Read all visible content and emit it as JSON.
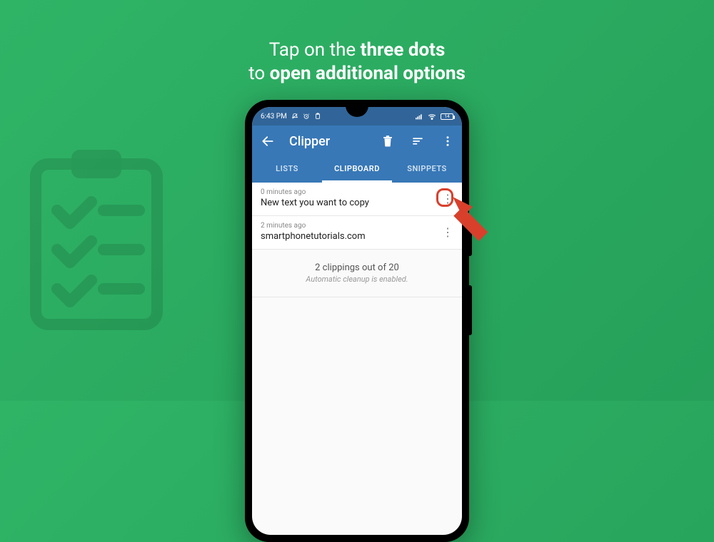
{
  "instruction": {
    "line1_pre": "Tap on the ",
    "line1_bold": "three dots",
    "line2_pre": "to ",
    "line2_bold": "open additional options"
  },
  "status": {
    "time": "6:43 PM",
    "battery": "14"
  },
  "appbar": {
    "title": "Clipper"
  },
  "tabs": {
    "lists": "LISTS",
    "clipboard": "CLIPBOARD",
    "snippets": "SNIPPETS",
    "active": "clipboard"
  },
  "items": [
    {
      "time": "0 minutes ago",
      "text": "New text you want to copy"
    },
    {
      "time": "2 minutes ago",
      "text": "smartphonetutorials.com"
    }
  ],
  "summary": {
    "count": "2 clippings out of 20",
    "note": "Automatic cleanup is enabled."
  },
  "colors": {
    "accent": "#3878b7",
    "highlight": "#d8402c"
  }
}
